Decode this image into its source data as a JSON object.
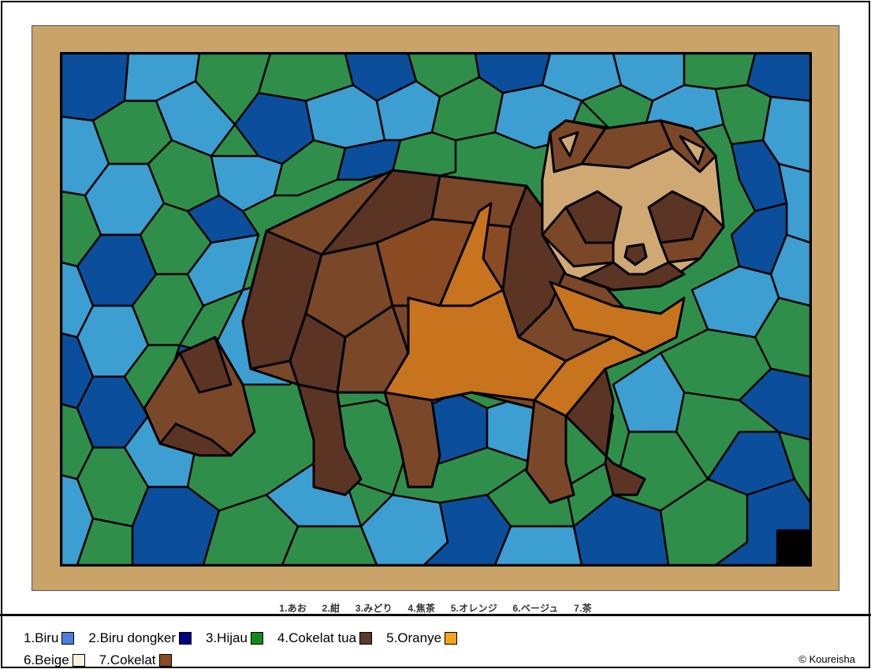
{
  "jp_legend": [
    "1.あお",
    "2.紺",
    "3.みどり",
    "4.焦茶",
    "5.オレンジ",
    "6.ベージュ",
    "7.茶"
  ],
  "legend": [
    {
      "label": "1.Biru",
      "color": "#4a7fe0"
    },
    {
      "label": "2.Biru dongker",
      "color": "#000080"
    },
    {
      "label": "3.Hijau",
      "color": "#108a1f"
    },
    {
      "label": "4.Cokelat tua",
      "color": "#5a3a2a"
    },
    {
      "label": "5.Oranye",
      "color": "#f5a31a"
    },
    {
      "label": "6.Beige",
      "color": "#f8f3dd"
    },
    {
      "label": "7.Cokelat",
      "color": "#8a4a22"
    }
  ],
  "copyright": "© Koureisha",
  "palette": {
    "light_blue": "#3d9ed1",
    "navy": "#0b4f9c",
    "green": "#2f8f4a",
    "dark_brown": "#5b3424",
    "brown": "#7a4728",
    "orange": "#c8731e",
    "beige": "#cfa874",
    "frame": "#c9a368"
  }
}
